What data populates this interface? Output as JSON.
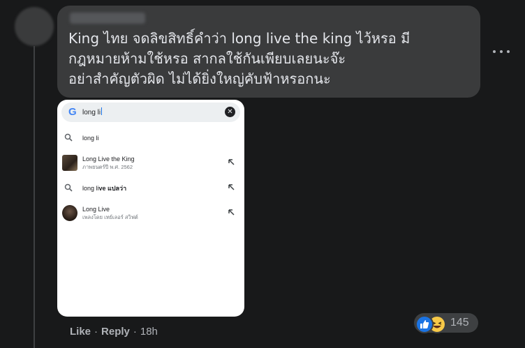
{
  "comment": {
    "text": "King ไทย จดลิขสิทธิ์คำว่า long live the king ไว้หรอ มี\nกฎหมายห้ามใช้หรอ สากลใช้กันเพียบเลยนะจ๊ะ\nอย่าสำคัญตัวผิด ไม่ได้ยิ่งใหญ่คับฟ้าหรอกนะ"
  },
  "attachment": {
    "search_query": "long li",
    "suggestions": [
      {
        "icon": "search-icon",
        "title": "long li",
        "bold_suffix": "",
        "subtitle": ""
      },
      {
        "icon": "movie-thumbnail",
        "title": "Long Live the King",
        "bold_suffix": "",
        "subtitle": "ภาพยนตร์ปี พ.ศ. 2562"
      },
      {
        "icon": "search-icon",
        "title": "long li",
        "bold_suffix": "ve แปลว่า",
        "subtitle": ""
      },
      {
        "icon": "artist-thumbnail",
        "title": "Long Live",
        "bold_suffix": "",
        "subtitle": "เพลงโดย เทย์เลอร์ สวิฟต์"
      }
    ]
  },
  "actions": {
    "like_label": "Like",
    "reply_label": "Reply",
    "timestamp": "18h",
    "separator": "·"
  },
  "reactions": {
    "count": "145",
    "types": [
      "like-icon",
      "haha-icon"
    ]
  },
  "colors": {
    "background": "#18191a",
    "bubble": "#3a3b3c",
    "text": "#e4e6eb",
    "secondary_text": "#b0b3b8",
    "like_blue": "#1b74e4",
    "haha_yellow": "#f7c948"
  }
}
